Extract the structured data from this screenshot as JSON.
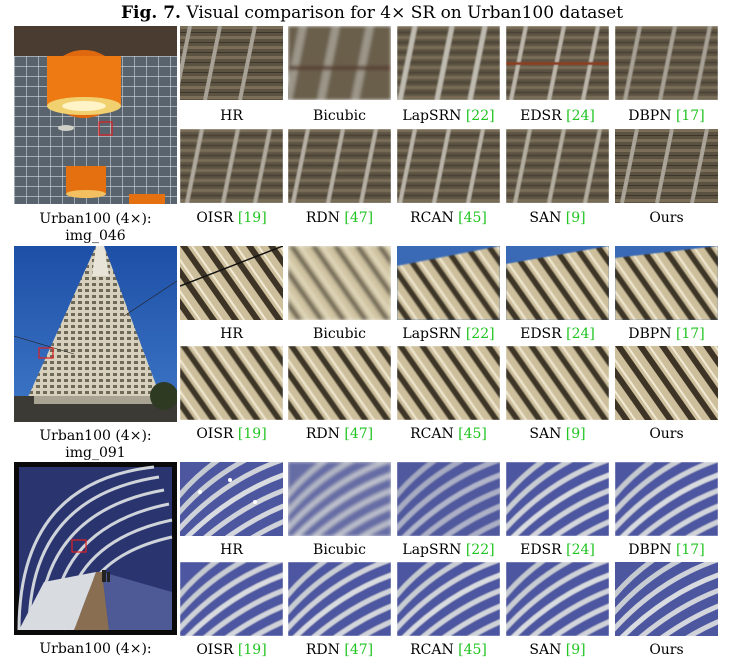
{
  "figure": {
    "label": "Fig. 7.",
    "caption": "Visual comparison for 4× SR on Urban100 dataset"
  },
  "methods_row1": [
    {
      "name": "HR",
      "ref": ""
    },
    {
      "name": "Bicubic",
      "ref": ""
    },
    {
      "name": "LapSRN ",
      "ref": "[22]"
    },
    {
      "name": "EDSR ",
      "ref": "[24]"
    },
    {
      "name": "DBPN ",
      "ref": "[17]"
    }
  ],
  "methods_row2": [
    {
      "name": "OISR ",
      "ref": "[19]"
    },
    {
      "name": "RDN ",
      "ref": "[47]"
    },
    {
      "name": "RCAN ",
      "ref": "[45]"
    },
    {
      "name": "SAN ",
      "ref": "[9]"
    },
    {
      "name": "Ours",
      "ref": ""
    }
  ],
  "groups": [
    {
      "caption_line1": "Urban100 (4×):",
      "caption_line2": "img_046"
    },
    {
      "caption_line1": "Urban100 (4×):",
      "caption_line2": "img_091"
    },
    {
      "caption_line1": "Urban100 (4×):",
      "caption_line2": ""
    }
  ],
  "colors": {
    "reference_link": "#22c422",
    "crop_box": "#e02020"
  }
}
